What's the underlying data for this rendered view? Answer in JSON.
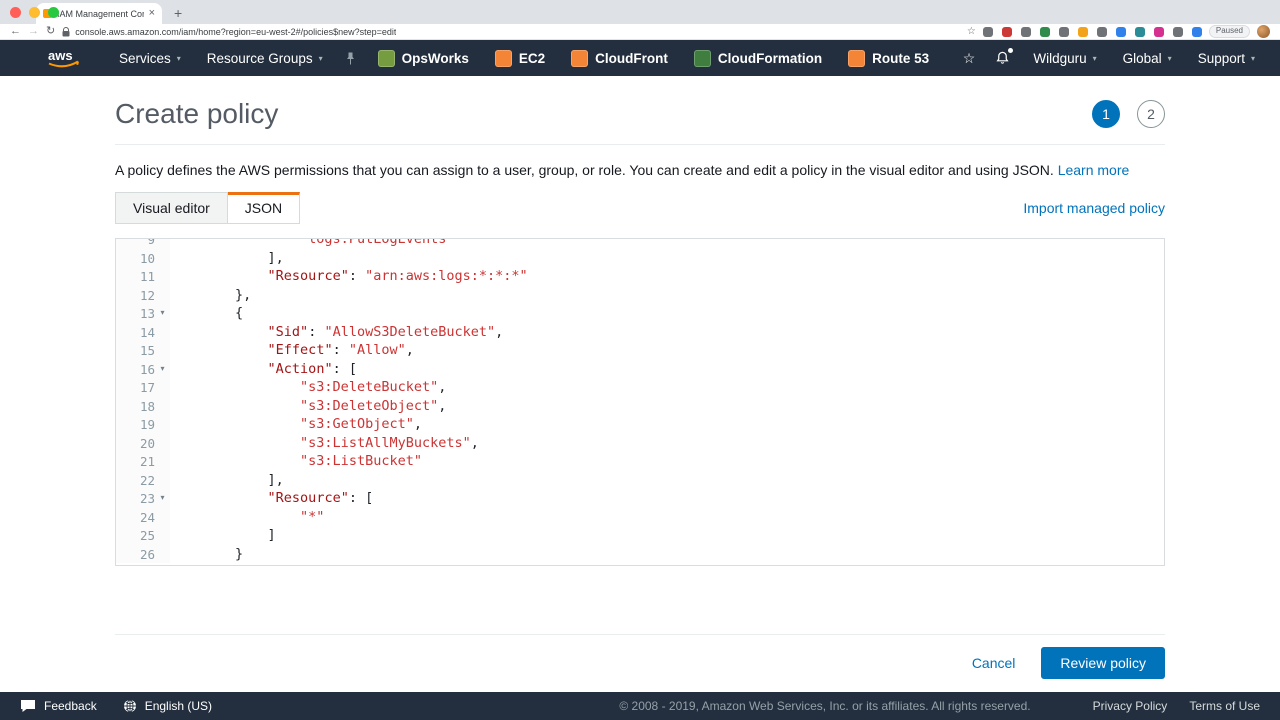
{
  "browser": {
    "tab_title": "IAM Management Console",
    "url": "console.aws.amazon.com/iam/home?region=eu-west-2#/policies$new?step=edit",
    "paused_label": "Paused",
    "extensions": [
      "#5f6368",
      "#c5221f",
      "#5f6368",
      "#188038",
      "#5f6368",
      "#f29900",
      "#5f6368",
      "#1a73e8",
      "#12808c",
      "#d01884",
      "#5f6368",
      "#1a73e8"
    ]
  },
  "nav": {
    "services_label": "Services",
    "resource_groups_label": "Resource Groups",
    "shortcuts": [
      {
        "label": "OpsWorks",
        "color": "#759c3e"
      },
      {
        "label": "EC2",
        "color": "#f58536"
      },
      {
        "label": "CloudFront",
        "color": "#f58536"
      },
      {
        "label": "CloudFormation",
        "color": "#3f7e3f"
      },
      {
        "label": "Route 53",
        "color": "#f58536"
      }
    ],
    "account_label": "Wildguru",
    "region_label": "Global",
    "support_label": "Support"
  },
  "page": {
    "title": "Create policy",
    "steps": [
      {
        "label": "1",
        "active": true
      },
      {
        "label": "2",
        "active": false
      }
    ],
    "description": "A policy defines the AWS permissions that you can assign to a user, group, or role. You can create and edit a policy in the visual editor and using JSON.",
    "learn_more_label": "Learn more",
    "tabs": [
      {
        "label": "Visual editor",
        "active": false
      },
      {
        "label": "JSON",
        "active": true
      }
    ],
    "import_link_label": "Import managed policy",
    "cancel_label": "Cancel",
    "review_button_label": "Review policy"
  },
  "editor": {
    "lines": [
      {
        "num": 9,
        "indent": 16,
        "fold": false,
        "seg": [
          [
            "s",
            "\"logs:PutLogEvents\""
          ]
        ]
      },
      {
        "num": 10,
        "indent": 12,
        "fold": false,
        "seg": [
          [
            "p",
            "],"
          ]
        ]
      },
      {
        "num": 11,
        "indent": 12,
        "fold": false,
        "seg": [
          [
            "k",
            "\"Resource\""
          ],
          [
            "p",
            ": "
          ],
          [
            "s",
            "\"arn:aws:logs:*:*:*\""
          ]
        ]
      },
      {
        "num": 12,
        "indent": 8,
        "fold": false,
        "seg": [
          [
            "p",
            "},"
          ]
        ]
      },
      {
        "num": 13,
        "indent": 8,
        "fold": true,
        "seg": [
          [
            "p",
            "{"
          ]
        ]
      },
      {
        "num": 14,
        "indent": 12,
        "fold": false,
        "seg": [
          [
            "k",
            "\"Sid\""
          ],
          [
            "p",
            ": "
          ],
          [
            "s",
            "\"AllowS3DeleteBucket\""
          ],
          [
            "p",
            ","
          ]
        ]
      },
      {
        "num": 15,
        "indent": 12,
        "fold": false,
        "seg": [
          [
            "k",
            "\"Effect\""
          ],
          [
            "p",
            ": "
          ],
          [
            "s",
            "\"Allow\""
          ],
          [
            "p",
            ","
          ]
        ]
      },
      {
        "num": 16,
        "indent": 12,
        "fold": true,
        "seg": [
          [
            "k",
            "\"Action\""
          ],
          [
            "p",
            ": ["
          ]
        ]
      },
      {
        "num": 17,
        "indent": 16,
        "fold": false,
        "seg": [
          [
            "s",
            "\"s3:DeleteBucket\""
          ],
          [
            "p",
            ","
          ]
        ]
      },
      {
        "num": 18,
        "indent": 16,
        "fold": false,
        "seg": [
          [
            "s",
            "\"s3:DeleteObject\""
          ],
          [
            "p",
            ","
          ]
        ]
      },
      {
        "num": 19,
        "indent": 16,
        "fold": false,
        "seg": [
          [
            "s",
            "\"s3:GetObject\""
          ],
          [
            "p",
            ","
          ]
        ]
      },
      {
        "num": 20,
        "indent": 16,
        "fold": false,
        "seg": [
          [
            "s",
            "\"s3:ListAllMyBuckets\""
          ],
          [
            "p",
            ","
          ]
        ]
      },
      {
        "num": 21,
        "indent": 16,
        "fold": false,
        "seg": [
          [
            "s",
            "\"s3:ListBucket\""
          ]
        ]
      },
      {
        "num": 22,
        "indent": 12,
        "fold": false,
        "seg": [
          [
            "p",
            "],"
          ]
        ]
      },
      {
        "num": 23,
        "indent": 12,
        "fold": true,
        "seg": [
          [
            "k",
            "\"Resource\""
          ],
          [
            "p",
            ": ["
          ]
        ]
      },
      {
        "num": 24,
        "indent": 16,
        "fold": false,
        "seg": [
          [
            "s",
            "\"*\""
          ]
        ]
      },
      {
        "num": 25,
        "indent": 12,
        "fold": false,
        "seg": [
          [
            "p",
            "]"
          ]
        ]
      },
      {
        "num": 26,
        "indent": 8,
        "fold": false,
        "seg": [
          [
            "p",
            "}"
          ]
        ]
      }
    ]
  },
  "footer": {
    "feedback_label": "Feedback",
    "language_label": "English (US)",
    "copyright": "© 2008 - 2019, Amazon Web Services, Inc. or its affiliates. All rights reserved.",
    "privacy_label": "Privacy Policy",
    "terms_label": "Terms of Use"
  },
  "colors": {
    "accent_blue": "#0073bb",
    "nav_bg": "#232f3e",
    "tab_accent": "#ec7211",
    "code_key": "#a31515",
    "code_string": "#cc3333"
  }
}
